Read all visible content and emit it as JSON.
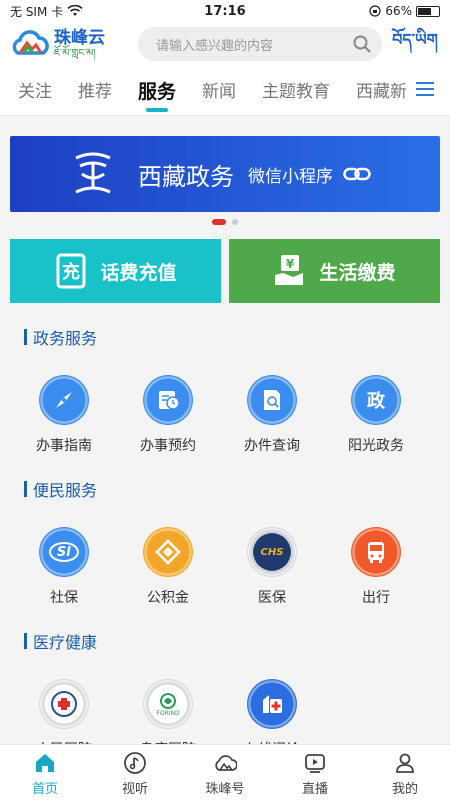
{
  "status": {
    "carrier": "无 SIM 卡",
    "time": "17:16",
    "battery": "66%",
    "battery_level": 0.66
  },
  "header": {
    "logo_cn": "珠峰云",
    "logo_tibetan": "ཇོ་མོ་གླང་མ།",
    "search_placeholder": "请输入感兴趣的内容",
    "tibetan_button": "བོད་ཡིག"
  },
  "tabs": [
    "关注",
    "推荐",
    "服务",
    "新闻",
    "主题教育",
    "西藏新"
  ],
  "active_tab": 2,
  "banner": {
    "title": "西藏政务",
    "subtitle": "微信小程序"
  },
  "quick": {
    "recharge": "话费充值",
    "bills": "生活缴费"
  },
  "sections": [
    {
      "title": "政务服务",
      "items": [
        {
          "label": "办事指南",
          "icon": "compass-icon"
        },
        {
          "label": "办事预约",
          "icon": "calendar-clock-icon"
        },
        {
          "label": "办件查询",
          "icon": "document-search-icon"
        },
        {
          "label": "阳光政务",
          "icon": "gov-badge-icon",
          "badge_text": "政"
        }
      ]
    },
    {
      "title": "便民服务",
      "items": [
        {
          "label": "社保",
          "icon": "social-security-icon",
          "badge_text": "SI"
        },
        {
          "label": "公积金",
          "icon": "housing-fund-icon"
        },
        {
          "label": "医保",
          "icon": "medical-insurance-icon",
          "badge_text": "CHS"
        },
        {
          "label": "出行",
          "icon": "bus-icon"
        }
      ]
    },
    {
      "title": "医疗健康",
      "items": [
        {
          "label": "人民医院",
          "icon": "hospital-logo-icon"
        },
        {
          "label": "阜康医院",
          "icon": "fukang-logo-icon",
          "badge_text": "FORIND"
        },
        {
          "label": "在线问诊",
          "icon": "online-consult-icon"
        }
      ]
    }
  ],
  "bottom_nav": [
    "首页",
    "视听",
    "珠峰号",
    "直播",
    "我的"
  ],
  "colors": {
    "accent": "#17b3c7",
    "brand_blue": "#1d62c4",
    "section_blue": "#1c5ea8"
  }
}
